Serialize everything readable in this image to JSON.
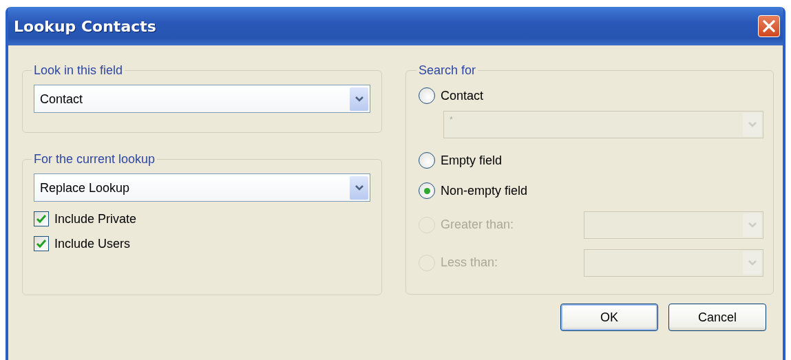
{
  "window": {
    "title": "Lookup Contacts"
  },
  "look_in_field": {
    "legend": "Look in this field",
    "value": "Contact"
  },
  "current_lookup": {
    "legend": "For the current lookup",
    "value": "Replace Lookup",
    "checkboxes": [
      {
        "label": "Include Private",
        "checked": true
      },
      {
        "label": "Include Users",
        "checked": true
      }
    ]
  },
  "search_for": {
    "legend": "Search for",
    "options": [
      {
        "kind": "field-below",
        "label": "Contact",
        "selected": false,
        "disabled": false,
        "field": {
          "value": "*",
          "disabled": true
        }
      },
      {
        "kind": "plain",
        "label": "Empty field",
        "selected": false,
        "disabled": false
      },
      {
        "kind": "plain",
        "label": "Non-empty field",
        "selected": true,
        "disabled": false
      },
      {
        "kind": "field-beside",
        "label": "Greater than:",
        "selected": false,
        "disabled": true,
        "field": {
          "disabled": true
        }
      },
      {
        "kind": "field-beside",
        "label": "Less than:",
        "selected": false,
        "disabled": true,
        "field": {
          "disabled": true
        }
      }
    ]
  },
  "buttons": [
    {
      "label": "OK",
      "default": true
    },
    {
      "label": "Cancel",
      "default": false
    }
  ]
}
